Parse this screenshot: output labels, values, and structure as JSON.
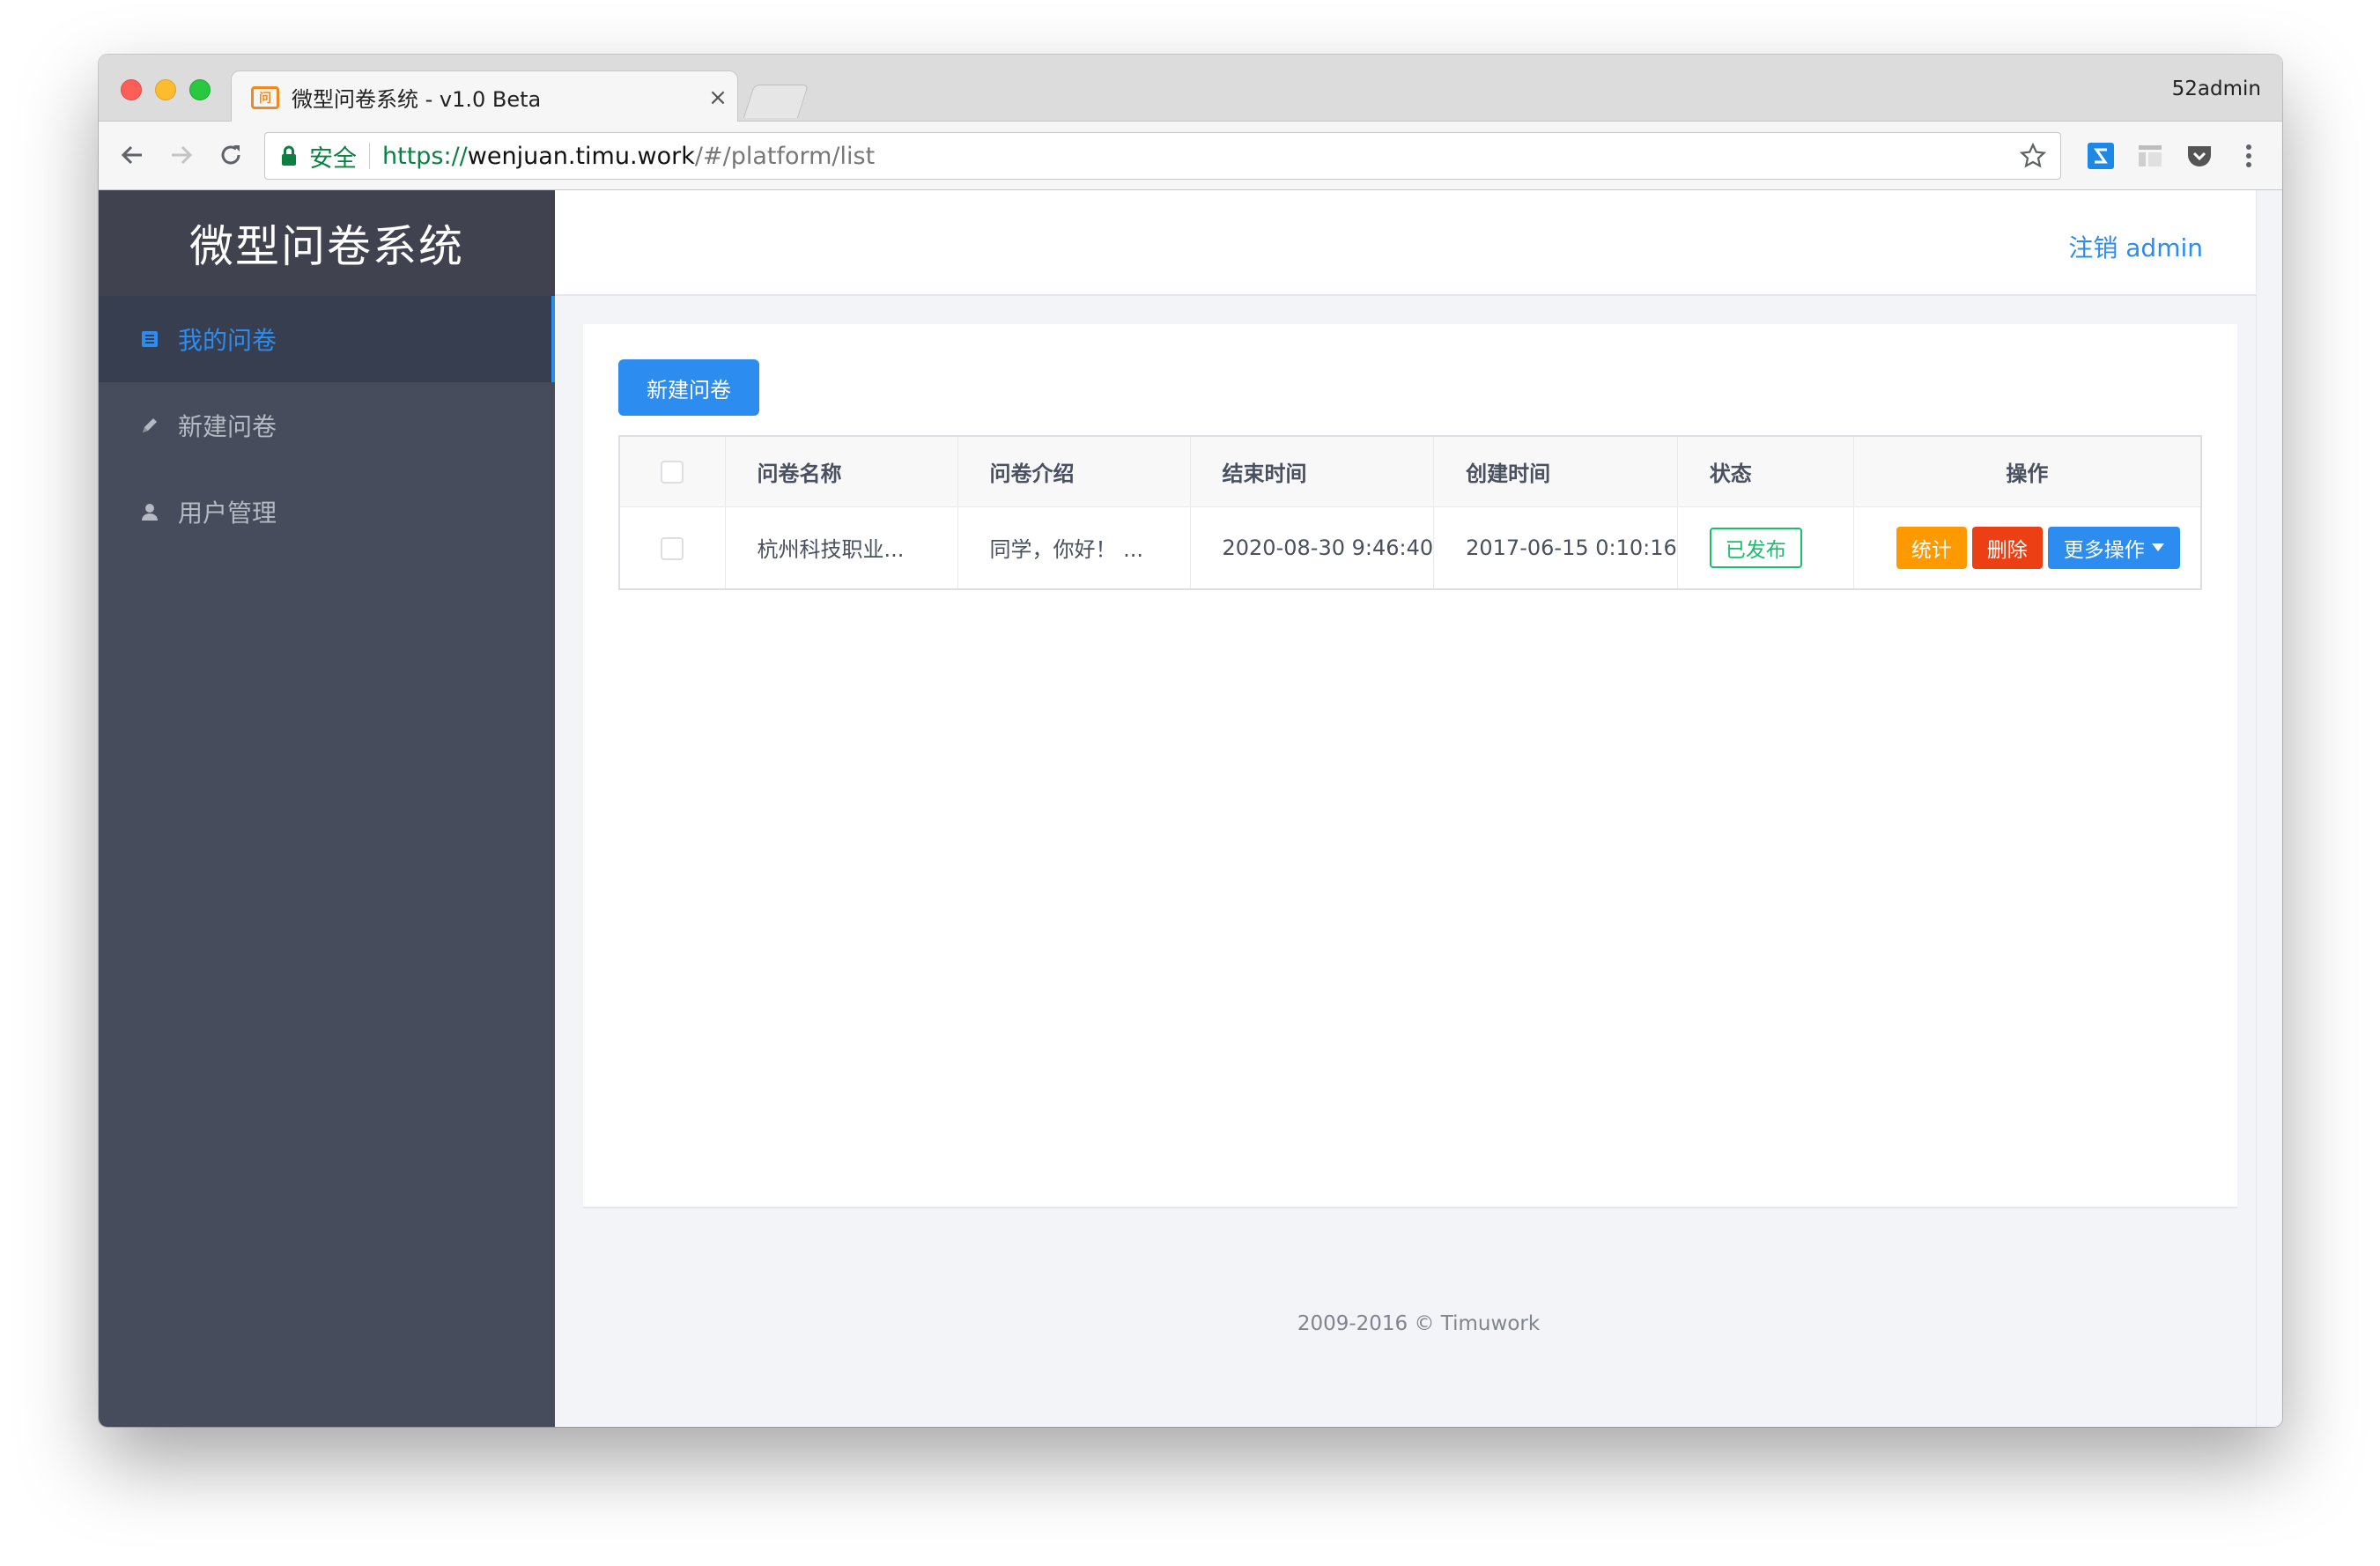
{
  "browser": {
    "tab_title": "微型问卷系统 - v1.0 Beta",
    "tab_favicon_text": "问",
    "tab_close": "×",
    "profile": "52admin",
    "secure_label": "安全",
    "url_scheme": "https://",
    "url_host": "wenjuan.timu.work",
    "url_path": "/#/platform/list"
  },
  "sidebar": {
    "brand": "微型问卷系统",
    "items": [
      {
        "label": "我的问卷",
        "icon": "list-icon",
        "active": true
      },
      {
        "label": "新建问卷",
        "icon": "pencil-icon",
        "active": false
      },
      {
        "label": "用户管理",
        "icon": "user-icon",
        "active": false
      }
    ]
  },
  "header": {
    "logout": "注销 admin"
  },
  "content": {
    "new_button": "新建问卷",
    "table": {
      "headers": [
        "问卷名称",
        "问卷介绍",
        "结束时间",
        "创建时间",
        "状态",
        "操作"
      ],
      "rows": [
        {
          "name": "杭州科技职业...",
          "intro": "同学，你好！ ...",
          "end_time": "2020-08-30 9:46:40",
          "created_time": "2017-06-15 0:10:16",
          "status": "已发布",
          "ops": {
            "stats": "统计",
            "delete": "删除",
            "more": "更多操作"
          }
        }
      ]
    }
  },
  "footer": "2009-2016 © Timuwork",
  "colors": {
    "primary": "#2d8cf0",
    "warning": "#ff9900",
    "error": "#ed3f14",
    "success": "#19be6b",
    "sidebar": "#464c5b"
  }
}
